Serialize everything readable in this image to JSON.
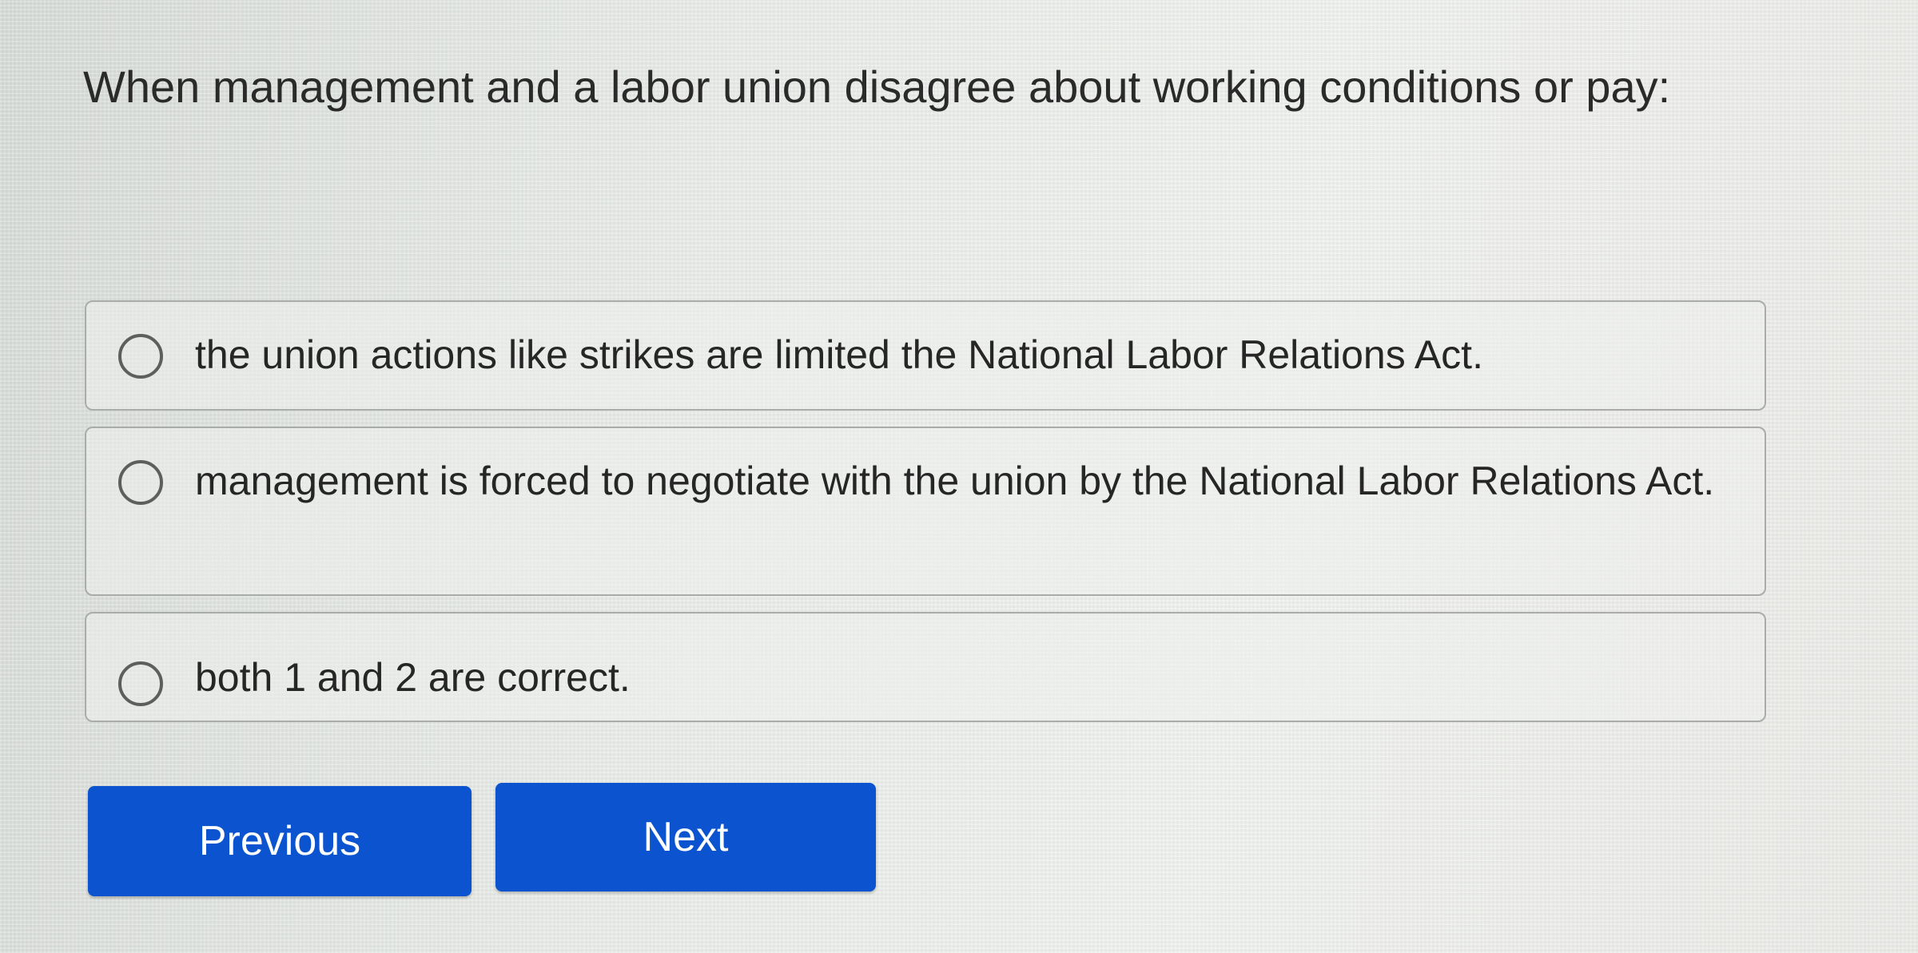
{
  "question": {
    "text": "When management and a labor union disagree about working conditions or pay:"
  },
  "options": [
    {
      "label": "the union actions like strikes are limited the National Labor Relations Act.",
      "selected": false
    },
    {
      "label": "management is forced to negotiate with the union by the National Labor Relations Act.",
      "selected": false
    },
    {
      "label": "both 1 and 2 are correct.",
      "selected": false
    }
  ],
  "navigation": {
    "previous_label": "Previous",
    "next_label": "Next"
  },
  "colors": {
    "button_background": "#0b53cf",
    "button_text": "#ffffff",
    "option_border": "#a9aca9",
    "radio_border": "#5c5f5c"
  }
}
